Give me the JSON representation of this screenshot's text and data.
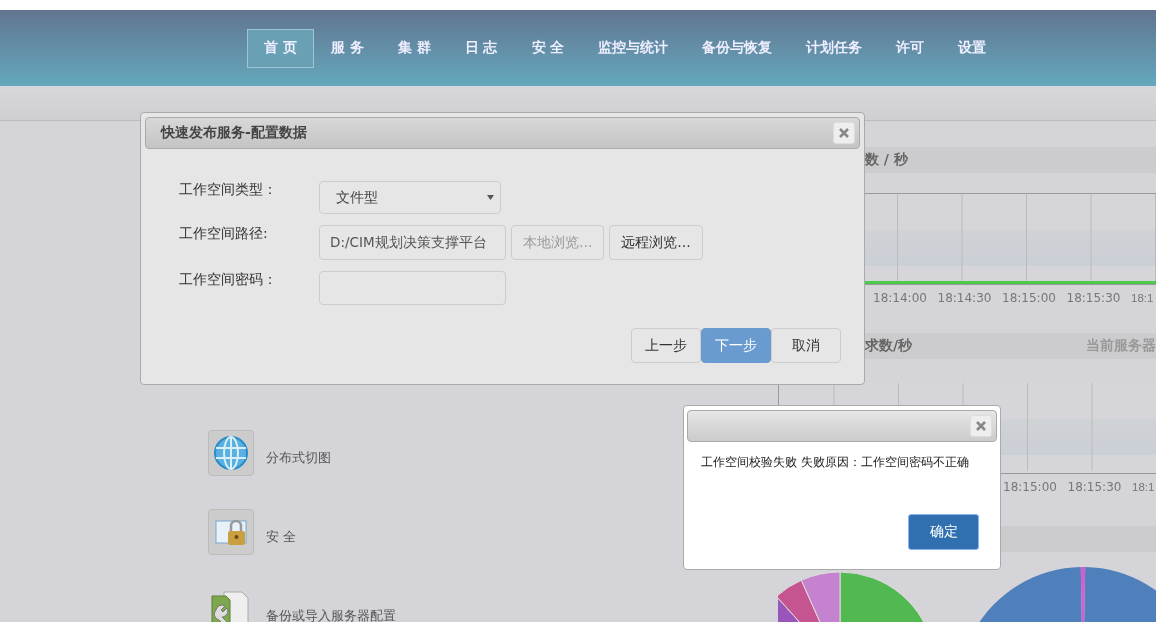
{
  "nav": {
    "items": [
      {
        "label": "首 页",
        "selected": true
      },
      {
        "label": "服 务",
        "selected": false
      },
      {
        "label": "集 群",
        "selected": false
      },
      {
        "label": "日 志",
        "selected": false
      },
      {
        "label": "安 全",
        "selected": false
      },
      {
        "label": "监控与统计",
        "selected": false
      },
      {
        "label": "备份与恢复",
        "selected": false
      },
      {
        "label": "计划任务",
        "selected": false
      },
      {
        "label": "许可",
        "selected": false
      },
      {
        "label": "设置",
        "selected": false
      }
    ]
  },
  "features": [
    {
      "kind": "globe",
      "label": "分布式切图"
    },
    {
      "kind": "lock",
      "label": "安 全"
    },
    {
      "kind": "backup",
      "label": "备份或导入服务器配置"
    }
  ],
  "panels": [
    {
      "title": "数 / 秒",
      "x_labels": [
        "18:14:00",
        "18:14:30",
        "18:15:00",
        "18:15:30",
        "18:1"
      ]
    },
    {
      "title": "求数/秒",
      "subtitle": "当前服务器",
      "x_labels": [
        "18:15:00",
        "18:15:30",
        "18:1"
      ]
    }
  ],
  "dialog": {
    "title": "快速发布服务-配置数据",
    "fields": [
      {
        "kind": "select",
        "label": "工作空间类型：",
        "value": "文件型"
      },
      {
        "kind": "path",
        "label": "工作空间路径:",
        "value": "D:/CIM规划决策支撑平台",
        "buttons": [
          {
            "label": "本地浏览...",
            "disabled": true
          },
          {
            "label": "远程浏览...",
            "disabled": false
          }
        ]
      },
      {
        "kind": "password",
        "label": "工作空间密码："
      }
    ],
    "buttons": [
      {
        "label": "上一步",
        "primary": false
      },
      {
        "label": "下一步",
        "primary": true
      },
      {
        "label": "取消",
        "primary": false
      }
    ]
  },
  "alert": {
    "message": "工作空间校验失败 失败原因：工作空间密码不正确",
    "button": "确定"
  }
}
